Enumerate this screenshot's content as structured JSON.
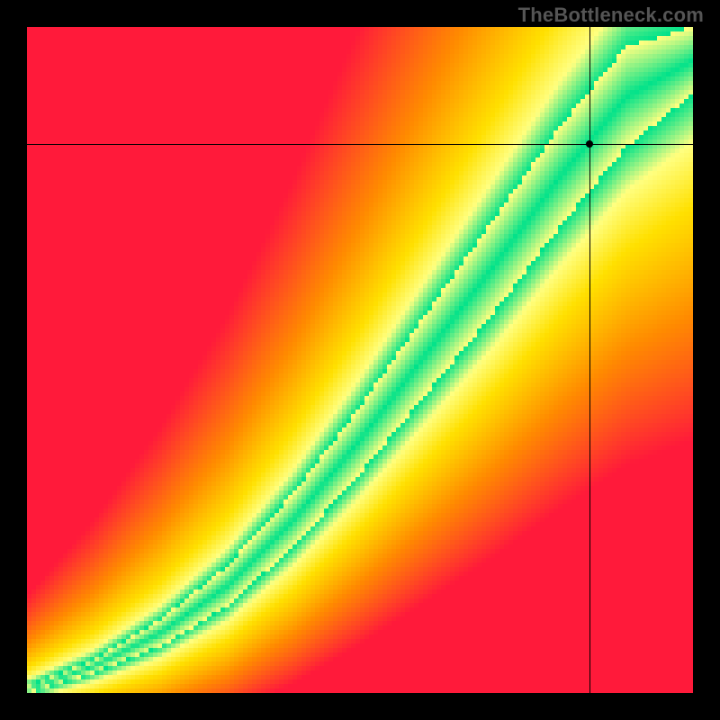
{
  "watermark": "TheBottleneck.com",
  "chart_data": {
    "type": "heatmap",
    "title": "",
    "xlabel": "",
    "ylabel": "",
    "xlim": [
      0,
      1
    ],
    "ylim": [
      0,
      1
    ],
    "grid": false,
    "legend": false,
    "marker": {
      "x": 0.845,
      "y": 0.825
    },
    "crosshair": {
      "x": 0.845,
      "y": 0.825
    },
    "optimal_band": {
      "description": "Green optimal-match ridge from lower-left to upper-right",
      "points": [
        {
          "x": 0.0,
          "lower": 0.0,
          "upper": 0.01
        },
        {
          "x": 0.1,
          "lower": 0.03,
          "upper": 0.05
        },
        {
          "x": 0.2,
          "lower": 0.07,
          "upper": 0.11
        },
        {
          "x": 0.3,
          "lower": 0.13,
          "upper": 0.19
        },
        {
          "x": 0.4,
          "lower": 0.22,
          "upper": 0.3
        },
        {
          "x": 0.5,
          "lower": 0.33,
          "upper": 0.43
        },
        {
          "x": 0.6,
          "lower": 0.45,
          "upper": 0.57
        },
        {
          "x": 0.7,
          "lower": 0.57,
          "upper": 0.71
        },
        {
          "x": 0.8,
          "lower": 0.7,
          "upper": 0.85
        },
        {
          "x": 0.9,
          "lower": 0.82,
          "upper": 0.97
        },
        {
          "x": 1.0,
          "lower": 0.9,
          "upper": 1.0
        }
      ]
    },
    "color_scale": [
      {
        "value": 0.0,
        "color": "#ff1a3a"
      },
      {
        "value": 0.5,
        "color": "#ffd000"
      },
      {
        "value": 0.8,
        "color": "#ffff66"
      },
      {
        "value": 1.0,
        "color": "#00e28a"
      }
    ]
  }
}
